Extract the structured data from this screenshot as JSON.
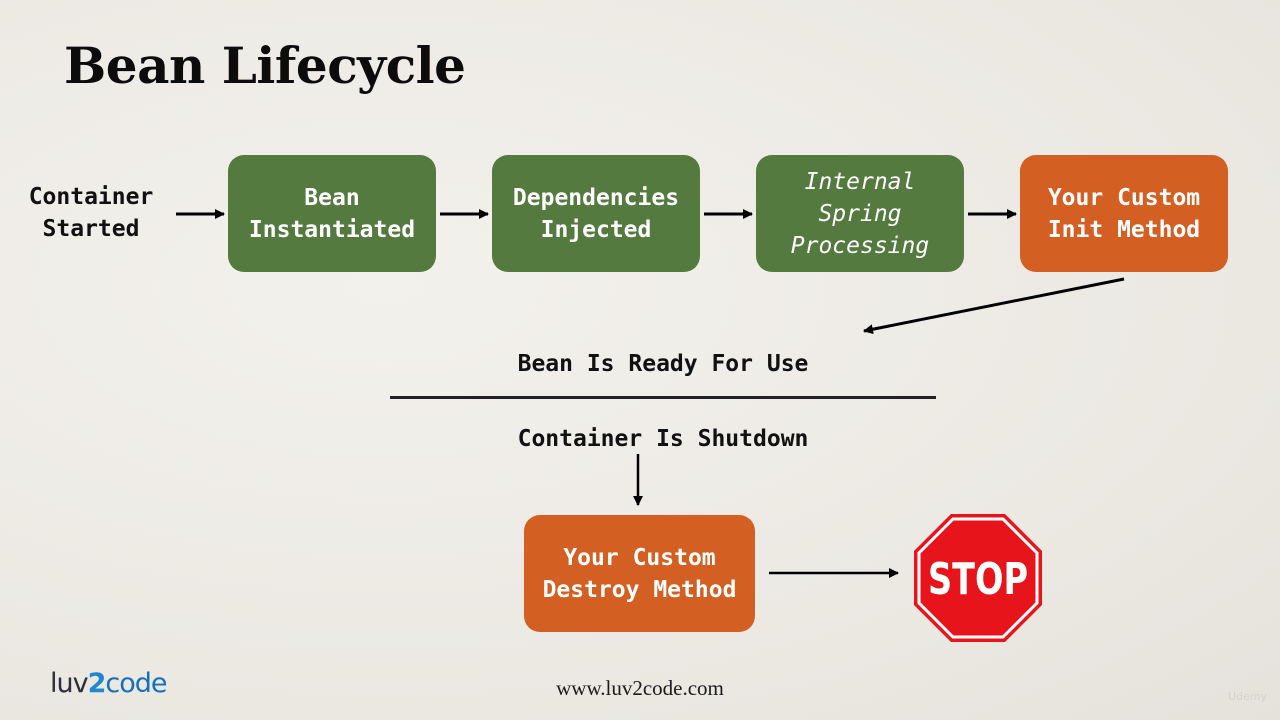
{
  "slide": {
    "title": "Bean Lifecycle",
    "footer_url": "www.luv2code.com",
    "logo": {
      "part1": "luv",
      "part2": "2",
      "part3": "code"
    },
    "watermark": "Udemy"
  },
  "flow": {
    "start_label": "Container\nStarted",
    "steps": [
      {
        "label": "Bean\nInstantiated",
        "color": "#547a40",
        "style": "normal"
      },
      {
        "label": "Dependencies\nInjected",
        "color": "#547a40",
        "style": "normal"
      },
      {
        "label": "Internal\nSpring\nProcessing",
        "color": "#547a40",
        "style": "italic"
      },
      {
        "label": "Your Custom\nInit Method",
        "color": "#d45f22",
        "style": "normal"
      }
    ],
    "ready_label": "Bean Is Ready For Use",
    "shutdown_label": "Container Is Shutdown",
    "destroy_step": {
      "label": "Your Custom\nDestroy Method",
      "color": "#d45f22"
    },
    "end_icon": {
      "name": "stop-sign",
      "text": "STOP",
      "color": "#e8141b"
    }
  }
}
